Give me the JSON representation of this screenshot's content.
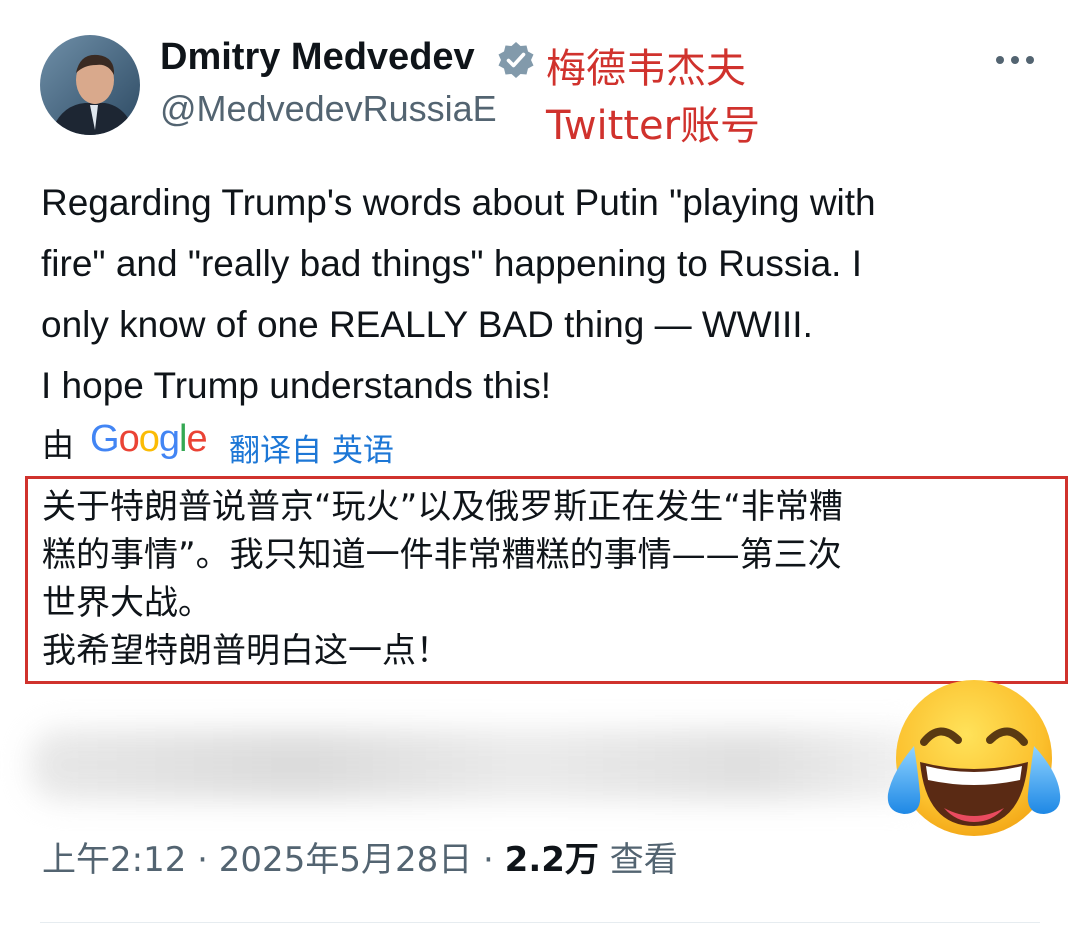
{
  "author": {
    "name": "Dmitry Medvedev",
    "handle": "@MedvedevRussiaE"
  },
  "annotation": {
    "line1": "梅德韦杰夫",
    "line2": "Twitter账号"
  },
  "tweet": {
    "lines": [
      "Regarding Trump's words about Putin \"playing with",
      "fire\" and \"really bad things\" happening to Russia. I",
      "only know of one REALLY BAD thing — WWIII.",
      "I hope Trump understands this!"
    ]
  },
  "translation": {
    "by_label": "由",
    "provider": "Google",
    "source_label": "翻译自 英语",
    "lines": [
      "关于特朗普说普京“玩火”以及俄罗斯正在发生“非常糟",
      "糕的事情”。我只知道一件非常糟糕的事情——第三次",
      "世界大战。",
      "我希望特朗普明白这一点！"
    ]
  },
  "meta": {
    "time": "上午2:12",
    "date": "2025年5月28日",
    "separator": "·",
    "views_count": "2.2万",
    "views_label": "查看"
  },
  "colors": {
    "accent_red": "#d0322d",
    "link_blue": "#1d77d6",
    "muted_gray": "#536471",
    "text": "#0f1419"
  }
}
